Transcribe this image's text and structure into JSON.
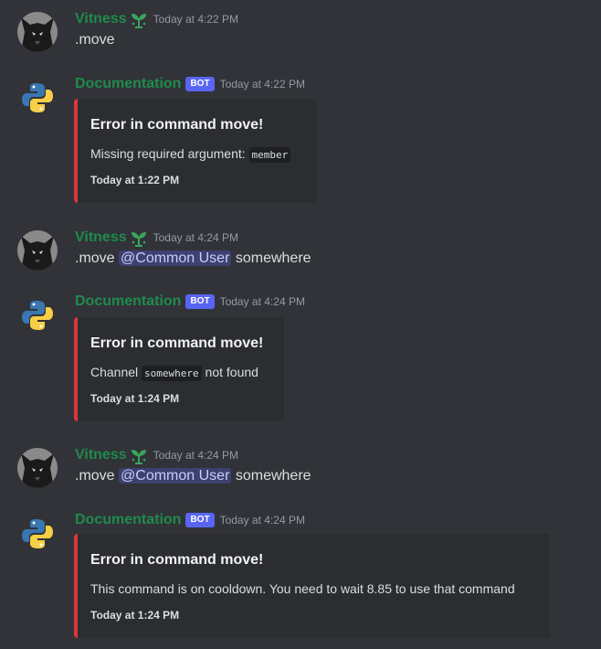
{
  "colors": {
    "background": "#313338",
    "username": "#1f8b4c",
    "bot_badge": "#5865f2",
    "embed_border": "#da373c",
    "embed_bg": "#2b2d31",
    "mention_bg": "#3c4270"
  },
  "messages": [
    {
      "author": "Vitness",
      "time": "Today at 4:22 PM",
      "content": ".move"
    },
    {
      "author": "Documentation",
      "badge": "BOT",
      "time": "Today at 4:22 PM",
      "embed": {
        "title": "Error in command move!",
        "desc_prefix": "Missing required argument: ",
        "code": "member",
        "desc_suffix": "",
        "footer": "Today at 1:22 PM"
      }
    },
    {
      "author": "Vitness",
      "time": "Today at 4:24 PM",
      "content_prefix": ".move ",
      "mention": "@Common User",
      "content_suffix": " somewhere"
    },
    {
      "author": "Documentation",
      "badge": "BOT",
      "time": "Today at 4:24 PM",
      "embed": {
        "title": "Error in command move!",
        "desc_prefix": "Channel ",
        "code": "somewhere",
        "desc_suffix": " not found",
        "footer": "Today at 1:24 PM"
      }
    },
    {
      "author": "Vitness",
      "time": "Today at 4:24 PM",
      "content_prefix": ".move ",
      "mention": "@Common User",
      "content_suffix": " somewhere"
    },
    {
      "author": "Documentation",
      "badge": "BOT",
      "time": "Today at 4:24 PM",
      "embed": {
        "title": "Error in command move!",
        "desc_prefix": "This command is on cooldown. You need to wait 8.85 to use that command",
        "footer": "Today at 1:24 PM"
      }
    }
  ],
  "icons": {
    "user_avatar": "wolf-avatar",
    "bot_avatar": "python-logo",
    "user_badge": "sprout-icon"
  }
}
